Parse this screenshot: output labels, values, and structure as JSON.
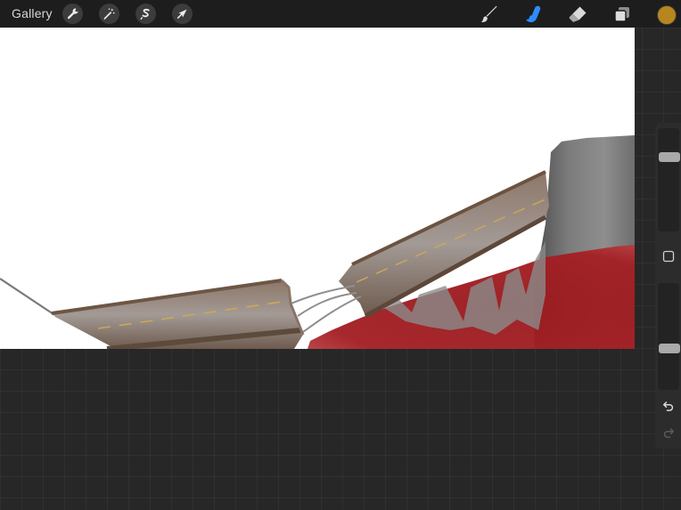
{
  "topbar": {
    "gallery_label": "Gallery",
    "actions": [
      {
        "name": "actions",
        "icon": "wrench-icon"
      },
      {
        "name": "adjustments",
        "icon": "magic-wand-icon"
      },
      {
        "name": "selection",
        "icon": "selection-s-icon"
      },
      {
        "name": "transform",
        "icon": "arrow-cursor-icon"
      }
    ],
    "tools": [
      {
        "name": "brush",
        "icon": "brush-icon",
        "active": false
      },
      {
        "name": "smudge",
        "icon": "smudge-finger-icon",
        "active": true
      },
      {
        "name": "eraser",
        "icon": "eraser-icon",
        "active": false
      },
      {
        "name": "layers",
        "icon": "layers-icon",
        "active": false
      }
    ],
    "current_color": "#b8861f"
  },
  "sidebar": {
    "brush_size_level": 0.75,
    "opacity_level": 0.37,
    "modify_icon": "square-icon",
    "undo_icon": "undo-arrow-icon",
    "redo_icon": "redo-arrow-icon"
  },
  "colors": {
    "accent": "#2f8cff",
    "canvas": "#ffffff",
    "topbar": "#1d1d1d",
    "blood": "#9a1a1e"
  }
}
